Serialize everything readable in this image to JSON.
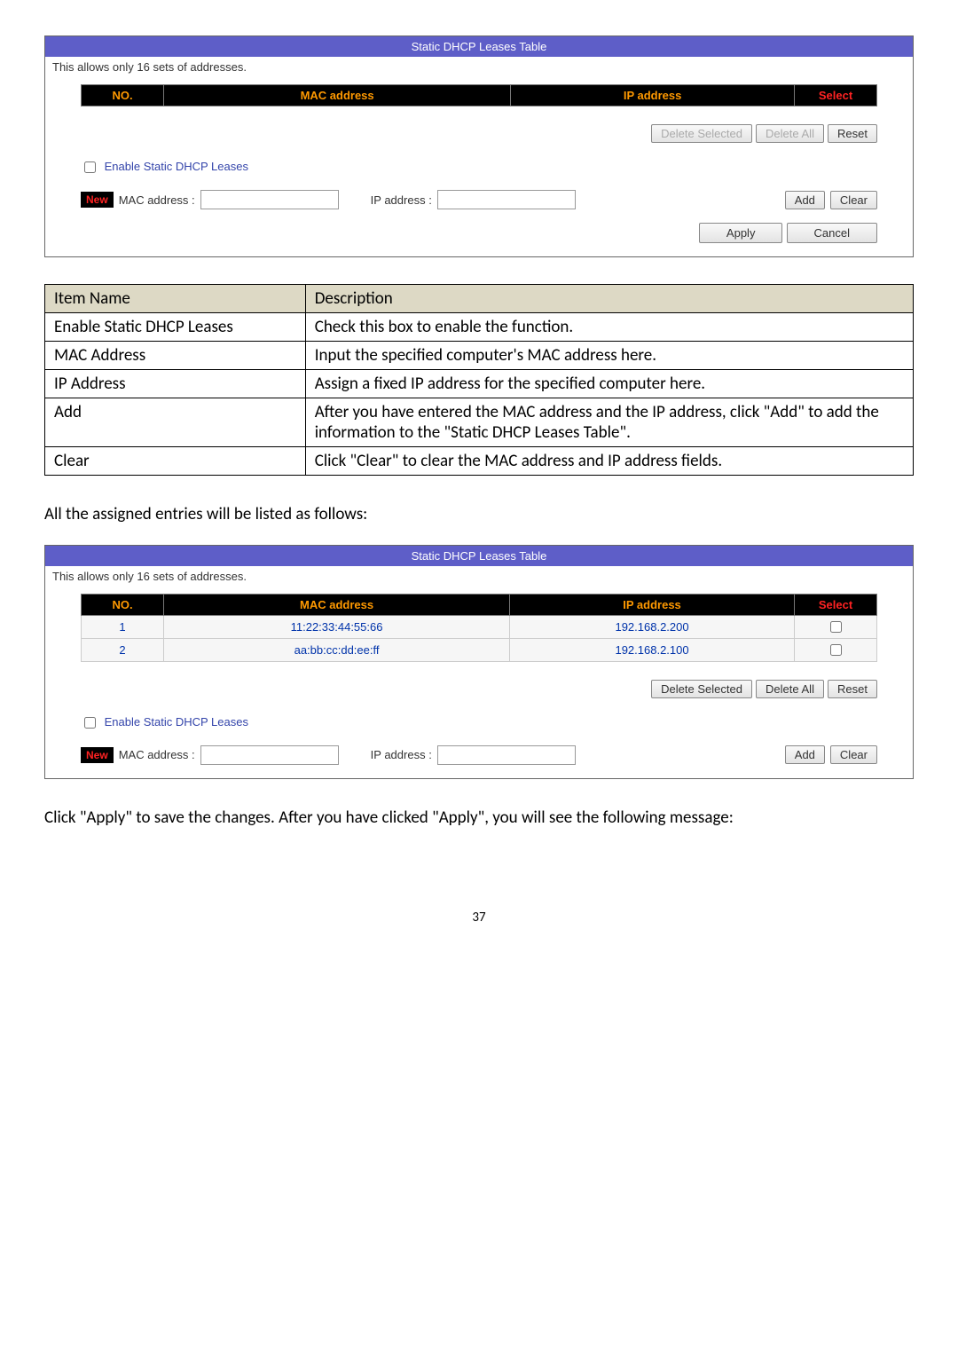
{
  "panel1": {
    "title": "Static DHCP Leases Table",
    "note": "This allows only 16 sets of addresses.",
    "cols": {
      "no": "NO.",
      "mac": "MAC address",
      "ip": "IP address",
      "select": "Select"
    },
    "delete_selected": "Delete Selected",
    "delete_all": "Delete All",
    "reset": "Reset",
    "enable_label": "Enable Static DHCP Leases",
    "new_badge": "New",
    "mac_label": "MAC address :",
    "ip_label": "IP address :",
    "add": "Add",
    "clear": "Clear",
    "apply": "Apply",
    "cancel": "Cancel"
  },
  "desc_table": {
    "h1": "Item Name",
    "h2": "Description",
    "rows": [
      {
        "name": "Enable Static DHCP Leases",
        "desc": "Check this box to enable the function."
      },
      {
        "name": "MAC Address",
        "desc": "Input the specified computer's MAC address here."
      },
      {
        "name": "IP Address",
        "desc": "Assign a fixed IP address for the specified computer here."
      },
      {
        "name": "Add",
        "desc": "After you have entered the MAC address and the IP address, click \"Add\" to add the information to the \"Static DHCP Leases Table\"."
      },
      {
        "name": "Clear",
        "desc": "Click \"Clear\" to clear the MAC address and IP address fields."
      }
    ]
  },
  "middle_text": "All the assigned entries will be listed as follows:",
  "panel2": {
    "title": "Static DHCP Leases Table",
    "note": "This allows only 16 sets of addresses.",
    "cols": {
      "no": "NO.",
      "mac": "MAC address",
      "ip": "IP address",
      "select": "Select"
    },
    "rows": [
      {
        "no": "1",
        "mac": "11:22:33:44:55:66",
        "ip": "192.168.2.200"
      },
      {
        "no": "2",
        "mac": "aa:bb:cc:dd:ee:ff",
        "ip": "192.168.2.100"
      }
    ],
    "delete_selected": "Delete Selected",
    "delete_all": "Delete All",
    "reset": "Reset",
    "enable_label": "Enable Static DHCP Leases",
    "new_badge": "New",
    "mac_label": "MAC address :",
    "ip_label": "IP address :",
    "add": "Add",
    "clear": "Clear"
  },
  "bottom_text": "Click \"Apply\" to save the changes. After you have clicked \"Apply\", you will see the following message:",
  "page_number": "37"
}
